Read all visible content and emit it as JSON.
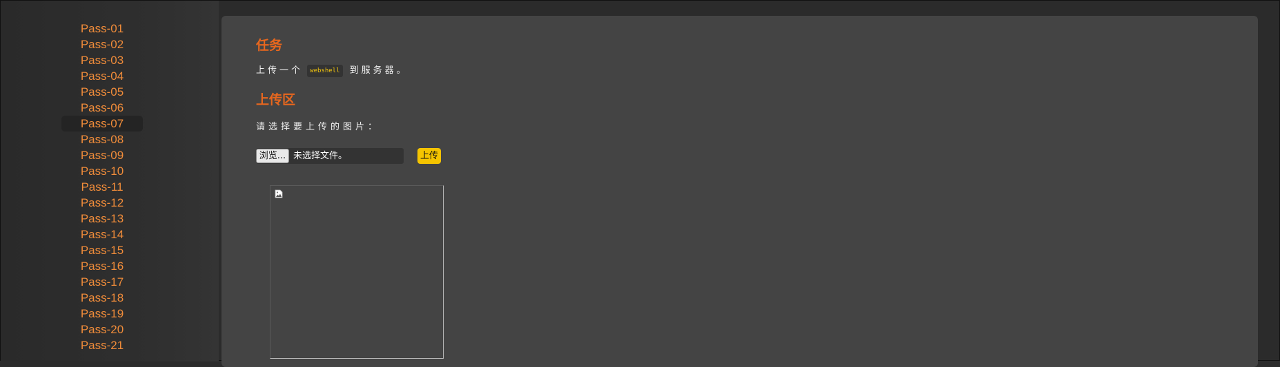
{
  "sidebar": {
    "items": [
      {
        "label": "Pass-01"
      },
      {
        "label": "Pass-02"
      },
      {
        "label": "Pass-03"
      },
      {
        "label": "Pass-04"
      },
      {
        "label": "Pass-05"
      },
      {
        "label": "Pass-06"
      },
      {
        "label": "Pass-07",
        "active": true
      },
      {
        "label": "Pass-08"
      },
      {
        "label": "Pass-09"
      },
      {
        "label": "Pass-10"
      },
      {
        "label": "Pass-11"
      },
      {
        "label": "Pass-12"
      },
      {
        "label": "Pass-13"
      },
      {
        "label": "Pass-14"
      },
      {
        "label": "Pass-15"
      },
      {
        "label": "Pass-16"
      },
      {
        "label": "Pass-17"
      },
      {
        "label": "Pass-18"
      },
      {
        "label": "Pass-19"
      },
      {
        "label": "Pass-20"
      },
      {
        "label": "Pass-21"
      }
    ]
  },
  "main": {
    "task_heading": "任务",
    "task_text_before": "上传一个",
    "task_code": "webshell",
    "task_text_after": "到服务器。",
    "upload_heading": "上传区",
    "upload_prompt": "请选择要上传的图片：",
    "browse_label": "浏览...",
    "file_status": "未选择文件。",
    "upload_button_label": "上传",
    "preview_icon": "broken-image-icon"
  },
  "colors": {
    "accent_orange": "#e8671e",
    "link_orange": "#f08c3a",
    "upload_button": "#f5c400",
    "panel_bg": "#444444",
    "page_bg": "#2b2b2b"
  }
}
